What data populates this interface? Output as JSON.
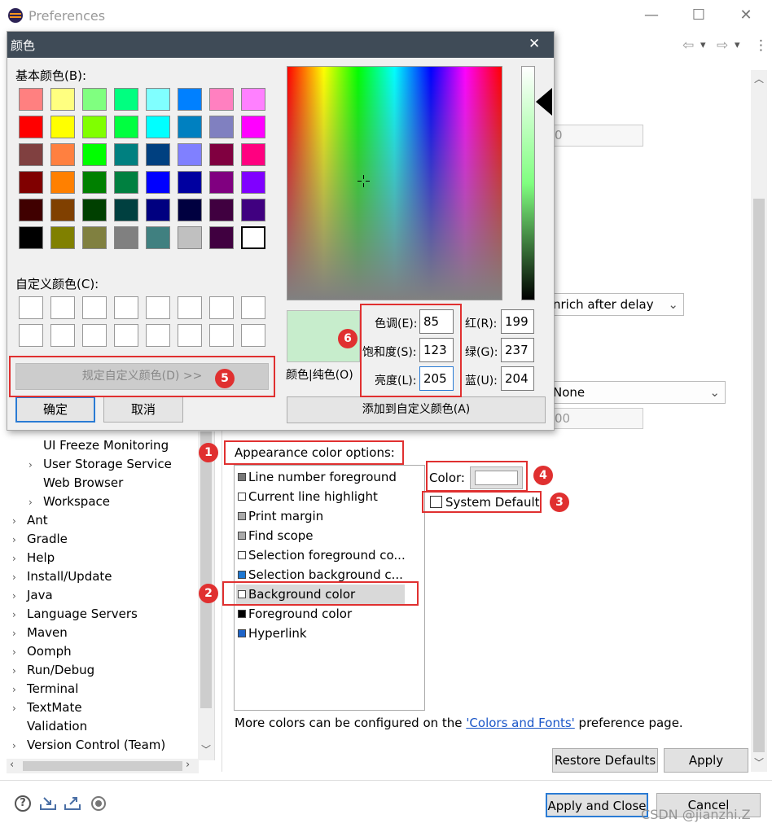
{
  "window": {
    "title": "Preferences",
    "minimize": "—",
    "maximize": "☐",
    "close": "✕"
  },
  "nav": {
    "back": "⇦",
    "forward": "⇨",
    "menu": "⋮",
    "dropdown": "▾"
  },
  "tree": {
    "sub_items": [
      {
        "label": "UI Freeze Monitoring",
        "chevron": ""
      },
      {
        "label": "User Storage Service",
        "chevron": "›"
      },
      {
        "label": "Web Browser",
        "chevron": ""
      },
      {
        "label": "Workspace",
        "chevron": "›"
      }
    ],
    "items": [
      {
        "label": "Ant",
        "chevron": "›"
      },
      {
        "label": "Gradle",
        "chevron": "›"
      },
      {
        "label": "Help",
        "chevron": "›"
      },
      {
        "label": "Install/Update",
        "chevron": "›"
      },
      {
        "label": "Java",
        "chevron": "›"
      },
      {
        "label": "Language Servers",
        "chevron": "›"
      },
      {
        "label": "Maven",
        "chevron": "›"
      },
      {
        "label": "Oomph",
        "chevron": "›"
      },
      {
        "label": "Run/Debug",
        "chevron": "›"
      },
      {
        "label": "Terminal",
        "chevron": "›"
      },
      {
        "label": "TextMate",
        "chevron": "›"
      },
      {
        "label": "Validation",
        "chevron": ""
      },
      {
        "label": "Version Control (Team)",
        "chevron": "›"
      }
    ]
  },
  "editor_prefs": {
    "field_value_1": "0",
    "hover_select": "nrich after delay",
    "none_select": "None",
    "field_value_2": "00",
    "appearance_label": "Appearance color options:",
    "color_list": [
      {
        "label": "Line number foreground",
        "color": "#777777"
      },
      {
        "label": "Current line highlight",
        "color": "#ffffff"
      },
      {
        "label": "Print margin",
        "color": "#aaaaaa"
      },
      {
        "label": "Find scope",
        "color": "#aaaaaa"
      },
      {
        "label": "Selection foreground co...",
        "color": "#ffffff"
      },
      {
        "label": "Selection background c...",
        "color": "#1e78d2"
      },
      {
        "label": "Background color",
        "color": "#ffffff"
      },
      {
        "label": "Foreground color",
        "color": "#000000"
      },
      {
        "label": "Hyperlink",
        "color": "#1e64c8"
      }
    ],
    "color_label": "Color:",
    "system_default": "System Default",
    "more_colors_prefix": "More colors can be configured on the ",
    "more_colors_link": "'Colors and Fonts'",
    "more_colors_suffix": " preference page.",
    "restore_defaults": "Restore Defaults",
    "apply": "Apply"
  },
  "footer": {
    "apply_close": "Apply and Close",
    "cancel": "Cancel",
    "help_icon": "?",
    "watermark": "CSDN @jianzhi.Z"
  },
  "badges": [
    "1",
    "2",
    "3",
    "4",
    "5",
    "6"
  ],
  "color_dialog": {
    "title": "颜色",
    "close": "✕",
    "basic_label": "基本颜色(B):",
    "basic_colors": [
      "#ff8080",
      "#ffff80",
      "#80ff80",
      "#00ff80",
      "#80ffff",
      "#0080ff",
      "#ff80c0",
      "#ff80ff",
      "#ff0000",
      "#ffff00",
      "#80ff00",
      "#00ff40",
      "#00ffff",
      "#0080c0",
      "#8080c0",
      "#ff00ff",
      "#804040",
      "#ff8040",
      "#00ff00",
      "#008080",
      "#004080",
      "#8080ff",
      "#800040",
      "#ff0080",
      "#800000",
      "#ff8000",
      "#008000",
      "#008040",
      "#0000ff",
      "#0000a0",
      "#800080",
      "#8000ff",
      "#400000",
      "#804000",
      "#004000",
      "#004040",
      "#000080",
      "#000040",
      "#400040",
      "#400080",
      "#000000",
      "#808000",
      "#808040",
      "#808080",
      "#408080",
      "#c0c0c0",
      "#400040",
      "#ffffff"
    ],
    "custom_label": "自定义颜色(C):",
    "define_custom": "规定自定义颜色(D) >>",
    "ok": "确定",
    "cancel": "取消",
    "hue_label": "色调(E):",
    "hue": "85",
    "sat_label": "饱和度(S):",
    "sat": "123",
    "lum_label": "亮度(L):",
    "lum": "205",
    "red_label": "红(R):",
    "red": "199",
    "green_label": "绿(G):",
    "green": "237",
    "blue_label": "蓝(U):",
    "blue": "204",
    "solid_label": "颜色|纯色(O)",
    "preview_color": "#c7edcc",
    "add_custom": "添加到自定义颜色(A)"
  }
}
